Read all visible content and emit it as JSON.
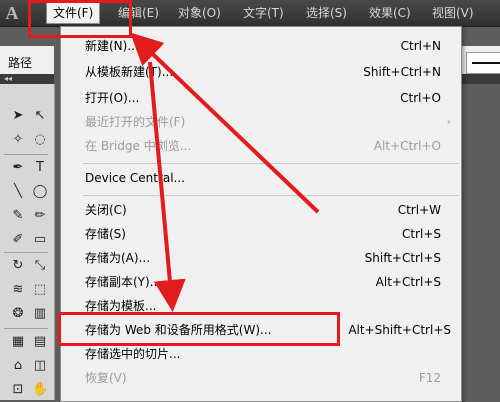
{
  "app": {
    "logo": "A"
  },
  "menubar": {
    "items": [
      {
        "label": "文件(F)"
      },
      {
        "label": "编辑(E)"
      },
      {
        "label": "对象(O)"
      },
      {
        "label": "文字(T)"
      },
      {
        "label": "选择(S)"
      },
      {
        "label": "效果(C)"
      },
      {
        "label": "视图(V)"
      }
    ]
  },
  "left_panel": {
    "label": "路径"
  },
  "file_menu": {
    "items": [
      {
        "label": "新建(N)...",
        "shortcut": "Ctrl+N",
        "disabled": false
      },
      {
        "label": "从模板新建(T)...",
        "shortcut": "Shift+Ctrl+N",
        "disabled": false
      },
      {
        "label": "打开(O)...",
        "shortcut": "Ctrl+O",
        "disabled": false
      },
      {
        "label": "最近打开的文件(F)",
        "shortcut": "",
        "disabled": true,
        "submenu": true
      },
      {
        "label": "在 Bridge 中浏览...",
        "shortcut": "Alt+Ctrl+O",
        "disabled": true
      },
      {
        "label": "Device Central...",
        "shortcut": "",
        "disabled": false
      },
      {
        "label": "关闭(C)",
        "shortcut": "Ctrl+W",
        "disabled": false
      },
      {
        "label": "存储(S)",
        "shortcut": "Ctrl+S",
        "disabled": false
      },
      {
        "label": "存储为(A)...",
        "shortcut": "Shift+Ctrl+S",
        "disabled": false
      },
      {
        "label": "存储副本(Y)...",
        "shortcut": "Alt+Ctrl+S",
        "disabled": false
      },
      {
        "label": "存储为模板...",
        "shortcut": "",
        "disabled": false
      },
      {
        "label": "存储为 Web 和设备所用格式(W)...",
        "shortcut": "Alt+Shift+Ctrl+S",
        "disabled": false,
        "highlighted": true
      },
      {
        "label": "存储选中的切片...",
        "shortcut": "",
        "disabled": false
      },
      {
        "label": "恢复(V)",
        "shortcut": "F12",
        "disabled": true
      }
    ]
  },
  "colors": {
    "annotation_red": "#e21c1c",
    "menu_bg": "#f0f0f0",
    "menubar_bg": "#3a3a3a"
  }
}
